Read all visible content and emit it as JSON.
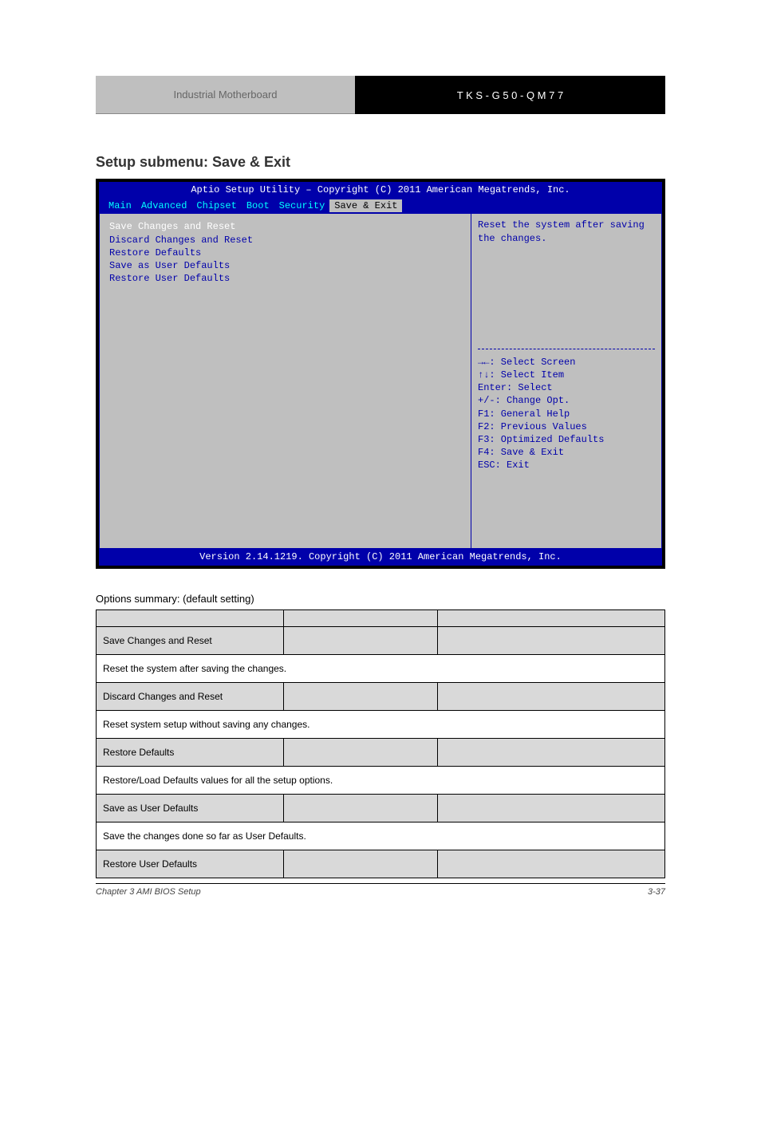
{
  "header": {
    "left": "Industrial Motherboard",
    "right": "T K S - G 5 0 - Q M 7 7"
  },
  "section_title": "Setup submenu: Save & Exit",
  "bios": {
    "title": "Aptio Setup Utility – Copyright (C) 2011 American Megatrends, Inc.",
    "tabs": [
      "Main",
      "Advanced",
      "Chipset",
      "Boot",
      "Security",
      "Save & Exit"
    ],
    "active_tab_index": 5,
    "menu_items": [
      "Save Changes and Reset",
      "Discard Changes and Reset",
      "",
      "Restore Defaults",
      "Save as User Defaults",
      "Restore User Defaults"
    ],
    "selected_item_index": 0,
    "help_text": "Reset the system after saving the changes.",
    "keys": [
      "→←: Select Screen",
      "↑↓: Select Item",
      "Enter: Select",
      "+/-: Change Opt.",
      "F1: General Help",
      "F2: Previous Values",
      "F3: Optimized Defaults",
      "F4: Save & Exit",
      "ESC: Exit"
    ],
    "footer": "Version 2.14.1219. Copyright (C) 2011 American Megatrends, Inc."
  },
  "options_label": "Options summary: (default setting)",
  "options_table": {
    "headers": [
      "",
      "",
      ""
    ],
    "rows": [
      {
        "type": "label",
        "cells": [
          "Save Changes and Reset",
          "",
          ""
        ]
      },
      {
        "type": "desc",
        "text": "Reset the system after saving the changes."
      },
      {
        "type": "label",
        "cells": [
          "Discard Changes and Reset",
          "",
          ""
        ]
      },
      {
        "type": "desc",
        "text": "Reset system setup without saving any changes."
      },
      {
        "type": "label",
        "cells": [
          "Restore Defaults",
          "",
          ""
        ]
      },
      {
        "type": "desc",
        "text": "Restore/Load Defaults values for all the setup options."
      },
      {
        "type": "label",
        "cells": [
          "Save as User Defaults",
          "",
          ""
        ]
      },
      {
        "type": "desc",
        "text": "Save the changes done so far as User Defaults."
      },
      {
        "type": "label",
        "cells": [
          "Restore User Defaults",
          "",
          ""
        ]
      }
    ]
  },
  "footer": {
    "left": "Chapter 3 AMI BIOS Setup",
    "right": "3-37"
  }
}
